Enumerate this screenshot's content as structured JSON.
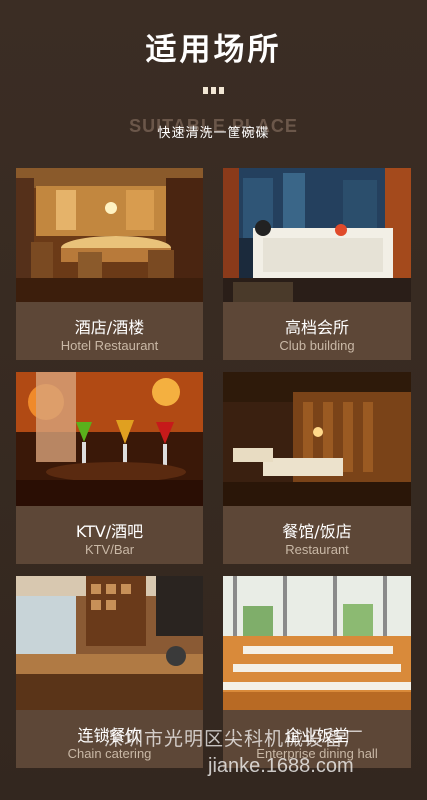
{
  "header": {
    "title": "适用场所",
    "watermark_text": "SUITABLE PLACE",
    "subtitle": "快速清洗一筐碗碟"
  },
  "cards": [
    {
      "cn": "酒店/酒楼",
      "en": "Hotel Restaurant"
    },
    {
      "cn": "高档会所",
      "en": "Club building"
    },
    {
      "cn": "KTV/酒吧",
      "en": "KTV/Bar"
    },
    {
      "cn": "餐馆/饭店",
      "en": "Restaurant"
    },
    {
      "cn": "连锁餐饮",
      "en": "Chain catering"
    },
    {
      "cn": "企业饭堂",
      "en": "Enterprise dining hall"
    }
  ],
  "watermark": {
    "company": "深圳市光明区尖科机械设备厂",
    "url": "jianke.1688.com"
  },
  "colors": {
    "background": "#3a2d24",
    "caption_bg": "#5d4737",
    "caption_en": "#c9b8a6"
  }
}
